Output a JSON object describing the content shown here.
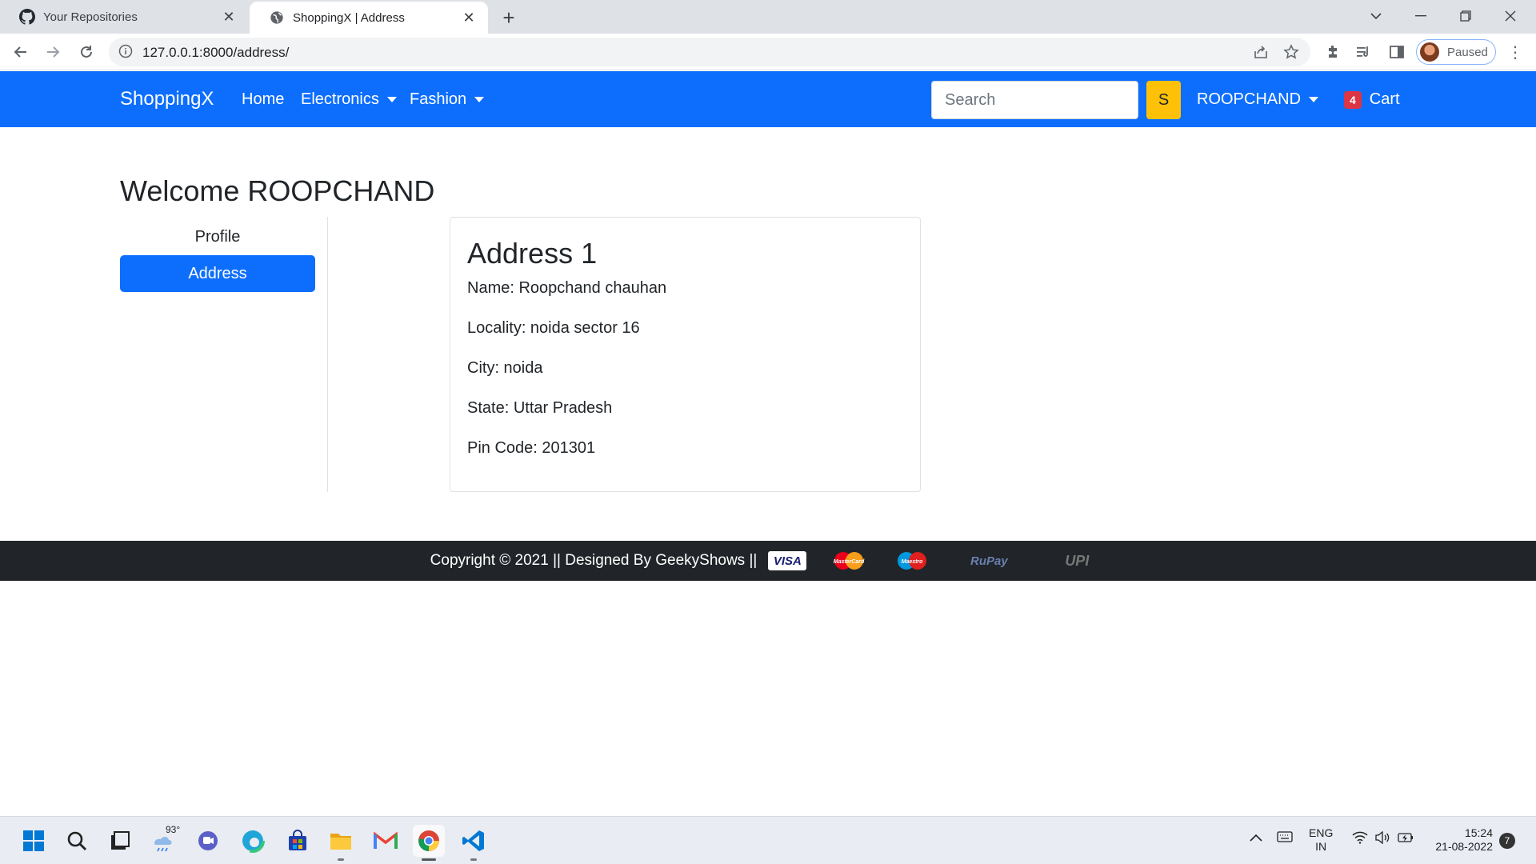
{
  "browser": {
    "tabs": [
      {
        "title": "Your Repositories",
        "icon": "github-icon"
      },
      {
        "title": "ShoppingX | Address",
        "icon": "globe-icon"
      }
    ],
    "url": "127.0.0.1:8000/address/",
    "profile_status": "Paused"
  },
  "navbar": {
    "brand": "ShoppingX",
    "links": [
      "Home",
      "Electronics",
      "Fashion"
    ],
    "search_placeholder": "Search",
    "search_button": "S",
    "user": "ROOPCHAND",
    "cart_count": "4",
    "cart_label": "Cart"
  },
  "page": {
    "welcome": "Welcome ROOPCHAND",
    "sidebar": [
      "Profile",
      "Address"
    ]
  },
  "address_card": {
    "title": "Address 1",
    "lines": [
      "Name: Roopchand chauhan",
      "Locality: noida sector 16",
      "City: noida",
      "State: Uttar Pradesh",
      "Pin Code: 201301"
    ]
  },
  "footer": {
    "text": "Copyright © 2021 || Designed By GeekyShows ||",
    "payments": [
      "VISA",
      "MasterCard",
      "Maestro",
      "RuPay",
      "UPI"
    ]
  },
  "taskbar": {
    "weather": "93°",
    "lang_top": "ENG",
    "lang_bottom": "IN",
    "time": "15:24",
    "date": "21-08-2022",
    "notifications": "7"
  },
  "colors": {
    "primary": "#0d6efd",
    "warning": "#ffc107",
    "danger": "#dc3545",
    "dark": "#212529"
  }
}
